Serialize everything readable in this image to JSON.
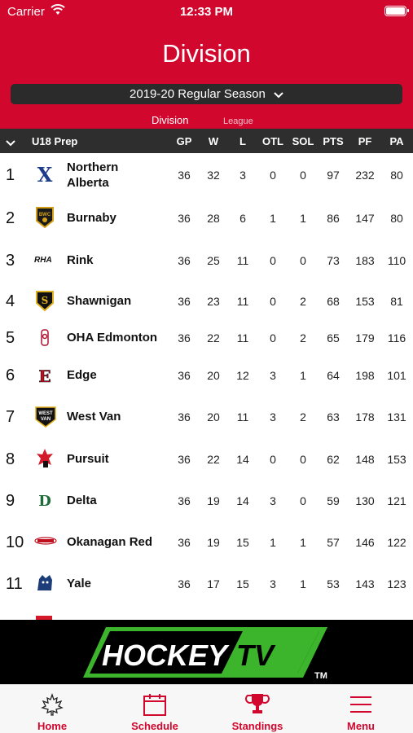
{
  "status_bar": {
    "carrier": "Carrier",
    "time": "12:33 PM"
  },
  "header": {
    "title": "Division",
    "season": "2019-20 Regular Season",
    "tabs": {
      "division": "Division",
      "league": "League"
    }
  },
  "table": {
    "division": "U18 Prep",
    "columns": [
      "GP",
      "W",
      "L",
      "OTL",
      "SOL",
      "PTS",
      "PF",
      "PA"
    ],
    "rows": [
      {
        "rank": "1",
        "team_lines": [
          "Northern",
          "Alberta"
        ],
        "logo": "northern-alberta-x-logo",
        "stats": [
          "36",
          "32",
          "3",
          "0",
          "0",
          "97",
          "232",
          "80"
        ]
      },
      {
        "rank": "2",
        "team_lines": [
          "Burnaby"
        ],
        "logo": "burnaby-winter-club-logo",
        "stats": [
          "36",
          "28",
          "6",
          "1",
          "1",
          "86",
          "147",
          "80"
        ]
      },
      {
        "rank": "3",
        "team_lines": [
          "Rink"
        ],
        "logo": "rink-hockey-academy-logo",
        "stats": [
          "36",
          "25",
          "11",
          "0",
          "0",
          "73",
          "183",
          "110"
        ]
      },
      {
        "rank": "4",
        "team_lines": [
          "Shawnigan"
        ],
        "logo": "shawnigan-logo",
        "stats": [
          "36",
          "23",
          "11",
          "0",
          "2",
          "68",
          "153",
          "81"
        ]
      },
      {
        "rank": "5",
        "team_lines": [
          "OHA Edmonton"
        ],
        "logo": "oha-edmonton-logo",
        "stats": [
          "36",
          "22",
          "11",
          "0",
          "2",
          "65",
          "179",
          "116"
        ]
      },
      {
        "rank": "6",
        "team_lines": [
          "Edge"
        ],
        "logo": "edge-logo",
        "stats": [
          "36",
          "20",
          "12",
          "3",
          "1",
          "64",
          "198",
          "101"
        ]
      },
      {
        "rank": "7",
        "team_lines": [
          "West Van"
        ],
        "logo": "west-van-logo",
        "stats": [
          "36",
          "20",
          "11",
          "3",
          "2",
          "63",
          "178",
          "131"
        ]
      },
      {
        "rank": "8",
        "team_lines": [
          "Pursuit"
        ],
        "logo": "pursuit-logo",
        "stats": [
          "36",
          "22",
          "14",
          "0",
          "0",
          "62",
          "148",
          "153"
        ]
      },
      {
        "rank": "9",
        "team_lines": [
          "Delta"
        ],
        "logo": "delta-logo",
        "stats": [
          "36",
          "19",
          "14",
          "3",
          "0",
          "59",
          "130",
          "121"
        ]
      },
      {
        "rank": "10",
        "team_lines": [
          "Okanagan Red"
        ],
        "logo": "okanagan-logo",
        "stats": [
          "36",
          "19",
          "15",
          "1",
          "1",
          "57",
          "146",
          "122"
        ]
      },
      {
        "rank": "11",
        "team_lines": [
          "Yale"
        ],
        "logo": "yale-logo",
        "stats": [
          "36",
          "17",
          "15",
          "3",
          "1",
          "53",
          "143",
          "123"
        ]
      }
    ]
  },
  "ad": {
    "logo_text": "HOCKEYTV",
    "brand_left": "HOCKEY",
    "brand_right": "TV",
    "trademark": "TM"
  },
  "tab_bar": [
    {
      "label": "Home",
      "icon": "maple-leaf-icon"
    },
    {
      "label": "Schedule",
      "icon": "calendar-icon"
    },
    {
      "label": "Standings",
      "icon": "trophy-icon"
    },
    {
      "label": "Menu",
      "icon": "menu-icon"
    }
  ],
  "colors": {
    "brand_red": "#d2072d",
    "dark": "#2e2e2e",
    "ad_green": "#3cb52c"
  }
}
